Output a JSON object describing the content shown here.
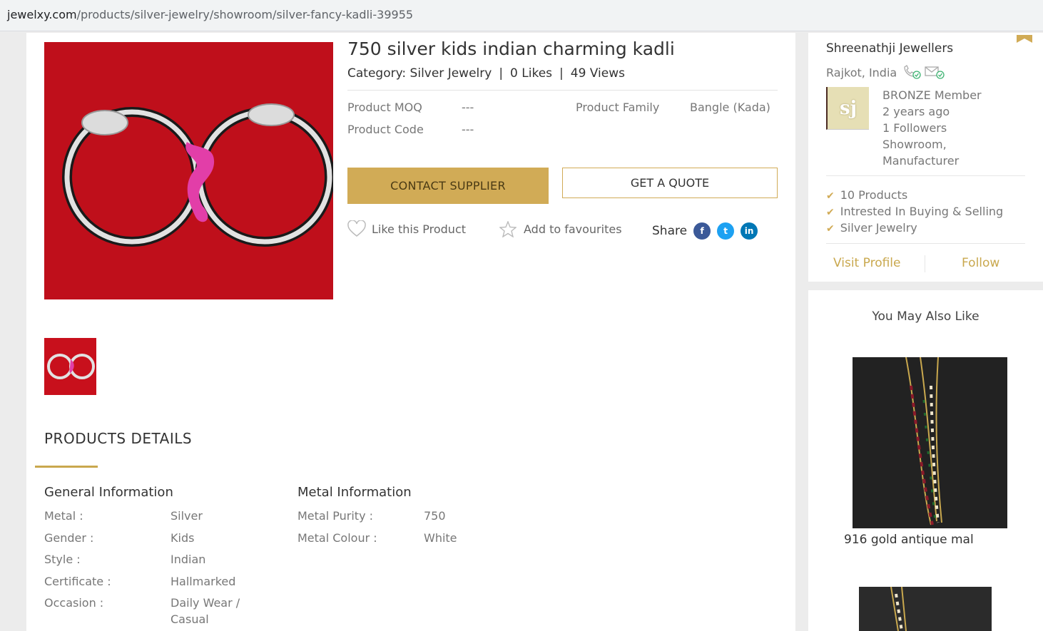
{
  "browser": {
    "url_host": "jewelxy.com",
    "url_path": "/products/silver-jewelry/showroom/silver-fancy-kadli-39955"
  },
  "product": {
    "title": "750 silver kids indian charming kadli",
    "category_label": "Category: Silver Jewelry",
    "likes": "0 Likes",
    "views": "49 Views",
    "moq_label": "Product MOQ",
    "moq_value": "---",
    "code_label": "Product Code",
    "code_value": "---",
    "family_label": "Product Family",
    "family_value": "Bangle (Kada)",
    "contact_button": "CONTACT SUPPLIER",
    "quote_button": "GET A QUOTE",
    "like_action": "Like this Product",
    "fav_action": "Add to favourites",
    "share_label": "Share"
  },
  "details": {
    "title": "PRODUCTS DETAILS",
    "general_title": "General Information",
    "general": [
      {
        "key": "Metal :",
        "value": "Silver"
      },
      {
        "key": "Gender :",
        "value": "Kids"
      },
      {
        "key": "Style :",
        "value": "Indian"
      },
      {
        "key": "Certificate :",
        "value": "Hallmarked"
      },
      {
        "key": "Occasion :",
        "value": "Daily Wear /",
        "value2": "Casual"
      }
    ],
    "metal_title": "Metal Information",
    "metal": [
      {
        "key": "Metal Purity :",
        "value": "750"
      },
      {
        "key": "Metal Colour :",
        "value": "White"
      }
    ]
  },
  "supplier": {
    "name": "Shreenathji Jewellers",
    "location": "Rajkot, India",
    "logo_text": "sj",
    "membership": "BRONZE Member",
    "joined": "2 years ago",
    "followers": "1 Followers",
    "type_line1": "Showroom,",
    "type_line2": "Manufacturer",
    "stats": [
      "10 Products",
      "Intrested In  Buying & Selling",
      "Silver Jewelry"
    ],
    "visit_profile": "Visit Profile",
    "follow": "Follow"
  },
  "suggestions": {
    "title": "You May Also Like",
    "items": [
      {
        "name": "916 gold antique mal"
      }
    ]
  },
  "colors": {
    "accent": "#d1ab56",
    "product_bg": "#c8101c",
    "facebook": "#3b5998",
    "twitter": "#1da1f2",
    "linkedin": "#0077b5"
  },
  "icons": [
    "heart-icon",
    "star-icon",
    "facebook-icon",
    "twitter-icon",
    "linkedin-icon",
    "phone-verified-icon",
    "mail-verified-icon",
    "check-icon",
    "bookmark-icon"
  ]
}
